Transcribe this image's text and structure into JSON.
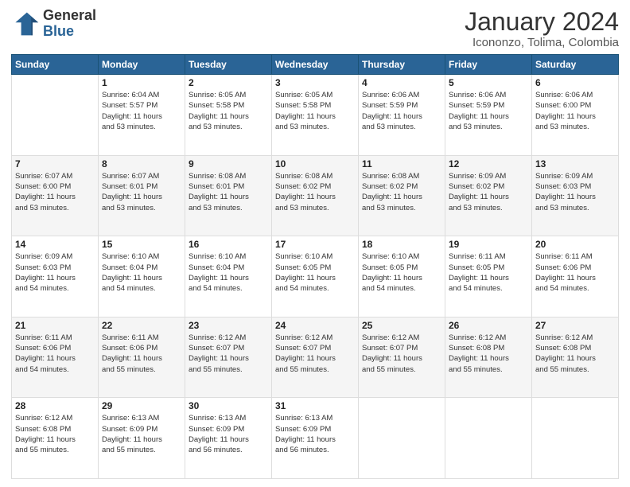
{
  "header": {
    "logo_general": "General",
    "logo_blue": "Blue",
    "month_title": "January 2024",
    "location": "Icononzo, Tolima, Colombia"
  },
  "weekdays": [
    "Sunday",
    "Monday",
    "Tuesday",
    "Wednesday",
    "Thursday",
    "Friday",
    "Saturday"
  ],
  "weeks": [
    [
      {
        "day": "",
        "info": ""
      },
      {
        "day": "1",
        "info": "Sunrise: 6:04 AM\nSunset: 5:57 PM\nDaylight: 11 hours\nand 53 minutes."
      },
      {
        "day": "2",
        "info": "Sunrise: 6:05 AM\nSunset: 5:58 PM\nDaylight: 11 hours\nand 53 minutes."
      },
      {
        "day": "3",
        "info": "Sunrise: 6:05 AM\nSunset: 5:58 PM\nDaylight: 11 hours\nand 53 minutes."
      },
      {
        "day": "4",
        "info": "Sunrise: 6:06 AM\nSunset: 5:59 PM\nDaylight: 11 hours\nand 53 minutes."
      },
      {
        "day": "5",
        "info": "Sunrise: 6:06 AM\nSunset: 5:59 PM\nDaylight: 11 hours\nand 53 minutes."
      },
      {
        "day": "6",
        "info": "Sunrise: 6:06 AM\nSunset: 6:00 PM\nDaylight: 11 hours\nand 53 minutes."
      }
    ],
    [
      {
        "day": "7",
        "info": "Sunrise: 6:07 AM\nSunset: 6:00 PM\nDaylight: 11 hours\nand 53 minutes."
      },
      {
        "day": "8",
        "info": "Sunrise: 6:07 AM\nSunset: 6:01 PM\nDaylight: 11 hours\nand 53 minutes."
      },
      {
        "day": "9",
        "info": "Sunrise: 6:08 AM\nSunset: 6:01 PM\nDaylight: 11 hours\nand 53 minutes."
      },
      {
        "day": "10",
        "info": "Sunrise: 6:08 AM\nSunset: 6:02 PM\nDaylight: 11 hours\nand 53 minutes."
      },
      {
        "day": "11",
        "info": "Sunrise: 6:08 AM\nSunset: 6:02 PM\nDaylight: 11 hours\nand 53 minutes."
      },
      {
        "day": "12",
        "info": "Sunrise: 6:09 AM\nSunset: 6:02 PM\nDaylight: 11 hours\nand 53 minutes."
      },
      {
        "day": "13",
        "info": "Sunrise: 6:09 AM\nSunset: 6:03 PM\nDaylight: 11 hours\nand 53 minutes."
      }
    ],
    [
      {
        "day": "14",
        "info": "Sunrise: 6:09 AM\nSunset: 6:03 PM\nDaylight: 11 hours\nand 54 minutes."
      },
      {
        "day": "15",
        "info": "Sunrise: 6:10 AM\nSunset: 6:04 PM\nDaylight: 11 hours\nand 54 minutes."
      },
      {
        "day": "16",
        "info": "Sunrise: 6:10 AM\nSunset: 6:04 PM\nDaylight: 11 hours\nand 54 minutes."
      },
      {
        "day": "17",
        "info": "Sunrise: 6:10 AM\nSunset: 6:05 PM\nDaylight: 11 hours\nand 54 minutes."
      },
      {
        "day": "18",
        "info": "Sunrise: 6:10 AM\nSunset: 6:05 PM\nDaylight: 11 hours\nand 54 minutes."
      },
      {
        "day": "19",
        "info": "Sunrise: 6:11 AM\nSunset: 6:05 PM\nDaylight: 11 hours\nand 54 minutes."
      },
      {
        "day": "20",
        "info": "Sunrise: 6:11 AM\nSunset: 6:06 PM\nDaylight: 11 hours\nand 54 minutes."
      }
    ],
    [
      {
        "day": "21",
        "info": "Sunrise: 6:11 AM\nSunset: 6:06 PM\nDaylight: 11 hours\nand 54 minutes."
      },
      {
        "day": "22",
        "info": "Sunrise: 6:11 AM\nSunset: 6:06 PM\nDaylight: 11 hours\nand 55 minutes."
      },
      {
        "day": "23",
        "info": "Sunrise: 6:12 AM\nSunset: 6:07 PM\nDaylight: 11 hours\nand 55 minutes."
      },
      {
        "day": "24",
        "info": "Sunrise: 6:12 AM\nSunset: 6:07 PM\nDaylight: 11 hours\nand 55 minutes."
      },
      {
        "day": "25",
        "info": "Sunrise: 6:12 AM\nSunset: 6:07 PM\nDaylight: 11 hours\nand 55 minutes."
      },
      {
        "day": "26",
        "info": "Sunrise: 6:12 AM\nSunset: 6:08 PM\nDaylight: 11 hours\nand 55 minutes."
      },
      {
        "day": "27",
        "info": "Sunrise: 6:12 AM\nSunset: 6:08 PM\nDaylight: 11 hours\nand 55 minutes."
      }
    ],
    [
      {
        "day": "28",
        "info": "Sunrise: 6:12 AM\nSunset: 6:08 PM\nDaylight: 11 hours\nand 55 minutes."
      },
      {
        "day": "29",
        "info": "Sunrise: 6:13 AM\nSunset: 6:09 PM\nDaylight: 11 hours\nand 55 minutes."
      },
      {
        "day": "30",
        "info": "Sunrise: 6:13 AM\nSunset: 6:09 PM\nDaylight: 11 hours\nand 56 minutes."
      },
      {
        "day": "31",
        "info": "Sunrise: 6:13 AM\nSunset: 6:09 PM\nDaylight: 11 hours\nand 56 minutes."
      },
      {
        "day": "",
        "info": ""
      },
      {
        "day": "",
        "info": ""
      },
      {
        "day": "",
        "info": ""
      }
    ]
  ]
}
